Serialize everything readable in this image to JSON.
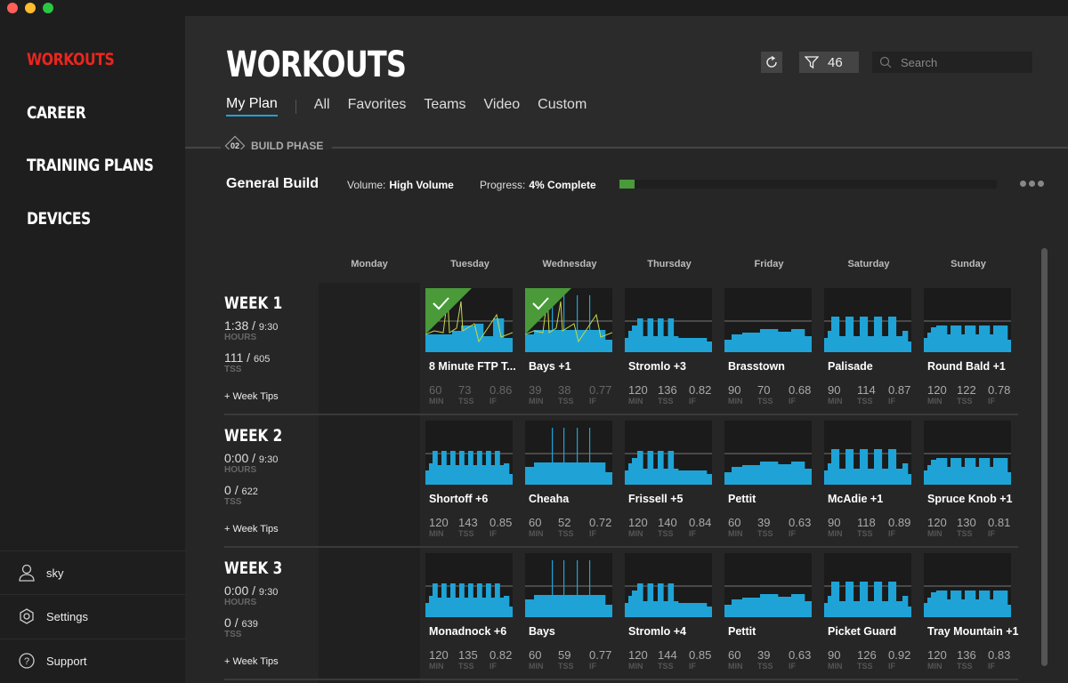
{
  "sidebar": {
    "items": [
      {
        "label": "WORKOUTS",
        "active": true
      },
      {
        "label": "CAREER"
      },
      {
        "label": "TRAINING PLANS"
      },
      {
        "label": "DEVICES"
      }
    ],
    "bottom": [
      {
        "label": "sky",
        "icon": "user-icon"
      },
      {
        "label": "Settings",
        "icon": "gear-icon"
      },
      {
        "label": "Support",
        "icon": "help-icon"
      }
    ]
  },
  "header": {
    "title": "WORKOUTS",
    "tabs": [
      {
        "label": "My Plan",
        "active": true
      },
      {
        "label": "All"
      },
      {
        "label": "Favorites"
      },
      {
        "label": "Teams"
      },
      {
        "label": "Video"
      },
      {
        "label": "Custom"
      }
    ],
    "filter_count": "46",
    "search_placeholder": "Search"
  },
  "phase": {
    "number": "02",
    "label": "BUILD PHASE"
  },
  "plan": {
    "name": "General Build",
    "volume_label": "Volume:",
    "volume": "High Volume",
    "progress_label": "Progress:",
    "progress_text": "4% Complete",
    "progress_percent": 4
  },
  "colors": {
    "accent": "#e8261f",
    "workout_blue": "#1fa3d6",
    "complete_green": "#4a9a3a"
  },
  "days": [
    "Monday",
    "Tuesday",
    "Wednesday",
    "Thursday",
    "Friday",
    "Saturday",
    "Sunday"
  ],
  "labels": {
    "hours": "HOURS",
    "tss": "TSS",
    "tips": "+ Week Tips",
    "min": "MIN",
    "if": "IF",
    "slash": "/"
  },
  "weeks": [
    {
      "title": "WEEK 1",
      "hours_done": "1:38",
      "hours_total": "9:30",
      "tss_done": "111",
      "tss_total": "605",
      "workouts": [
        {
          "name": "8 Minute FTP T...",
          "min": "60",
          "tss": "73",
          "if": "0.86",
          "completed": true,
          "profile": "ftp"
        },
        {
          "name": "Bays +1",
          "min": "39",
          "tss": "38",
          "if": "0.77",
          "completed": true,
          "profile": "spikes"
        },
        {
          "name": "Stromlo +3",
          "min": "120",
          "tss": "136",
          "if": "0.82",
          "profile": "over4"
        },
        {
          "name": "Brasstown",
          "min": "90",
          "tss": "70",
          "if": "0.68",
          "profile": "steady"
        },
        {
          "name": "Palisade",
          "min": "90",
          "tss": "114",
          "if": "0.87",
          "profile": "over5"
        },
        {
          "name": "Round Bald +1",
          "min": "120",
          "tss": "122",
          "if": "0.78",
          "profile": "blocks"
        }
      ]
    },
    {
      "title": "WEEK 2",
      "hours_done": "0:00",
      "hours_total": "9:30",
      "tss_done": "0",
      "tss_total": "622",
      "workouts": [
        {
          "name": "Shortoff +6",
          "min": "120",
          "tss": "143",
          "if": "0.85",
          "profile": "many"
        },
        {
          "name": "Cheaha",
          "min": "60",
          "tss": "52",
          "if": "0.72",
          "profile": "spikes"
        },
        {
          "name": "Frissell +5",
          "min": "120",
          "tss": "140",
          "if": "0.84",
          "profile": "over4"
        },
        {
          "name": "Pettit",
          "min": "60",
          "tss": "39",
          "if": "0.63",
          "profile": "steady"
        },
        {
          "name": "McAdie +1",
          "min": "90",
          "tss": "118",
          "if": "0.89",
          "profile": "over5"
        },
        {
          "name": "Spruce Knob +1",
          "min": "120",
          "tss": "130",
          "if": "0.81",
          "profile": "blocks"
        }
      ]
    },
    {
      "title": "WEEK 3",
      "hours_done": "0:00",
      "hours_total": "9:30",
      "tss_done": "0",
      "tss_total": "639",
      "workouts": [
        {
          "name": "Monadnock +6",
          "min": "120",
          "tss": "135",
          "if": "0.82",
          "profile": "many"
        },
        {
          "name": "Bays",
          "min": "60",
          "tss": "59",
          "if": "0.77",
          "profile": "spikes"
        },
        {
          "name": "Stromlo +4",
          "min": "120",
          "tss": "144",
          "if": "0.85",
          "profile": "over4"
        },
        {
          "name": "Pettit",
          "min": "60",
          "tss": "39",
          "if": "0.63",
          "profile": "steady"
        },
        {
          "name": "Picket Guard",
          "min": "90",
          "tss": "126",
          "if": "0.92",
          "profile": "over5"
        },
        {
          "name": "Tray Mountain +1",
          "min": "120",
          "tss": "136",
          "if": "0.83",
          "profile": "blocks"
        }
      ]
    }
  ]
}
